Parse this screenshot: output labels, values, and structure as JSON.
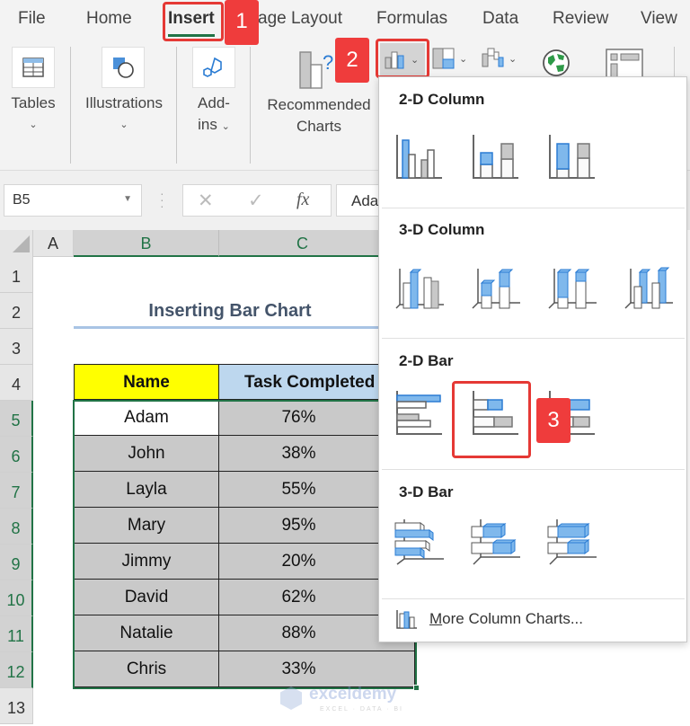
{
  "tabs": [
    {
      "label": "File"
    },
    {
      "label": "Home"
    },
    {
      "label": "Insert",
      "active": true
    },
    {
      "label": "age Layout"
    },
    {
      "label": "Formulas"
    },
    {
      "label": "Data"
    },
    {
      "label": "Review"
    },
    {
      "label": "View"
    }
  ],
  "callouts": {
    "step1": "1",
    "step2": "2",
    "step3": "3"
  },
  "ribbon": {
    "tables": "Tables",
    "illustrations": "Illustrations",
    "addins_line1": "Add-",
    "addins_line2": "ins",
    "recommended_line1": "Recommended",
    "recommended_line2": "Charts",
    "caret": "⌄"
  },
  "formula_bar": {
    "name_box": "B5",
    "cancel": "✕",
    "enter": "✓",
    "fx": "fx",
    "content": "Adam"
  },
  "grid": {
    "columns": [
      "A",
      "B",
      "C"
    ],
    "rows": [
      "1",
      "2",
      "3",
      "4",
      "5",
      "6",
      "7",
      "8",
      "9",
      "10",
      "11",
      "12",
      "13"
    ]
  },
  "sheet": {
    "title": "Inserting Bar Chart",
    "headers": {
      "name": "Name",
      "task": "Task Completed"
    },
    "rows": [
      {
        "name": "Adam",
        "pct": "76%"
      },
      {
        "name": "John",
        "pct": "38%"
      },
      {
        "name": "Layla",
        "pct": "55%"
      },
      {
        "name": "Mary",
        "pct": "95%"
      },
      {
        "name": "Jimmy",
        "pct": "20%"
      },
      {
        "name": "David",
        "pct": "62%"
      },
      {
        "name": "Natalie",
        "pct": "88%"
      },
      {
        "name": "Chris",
        "pct": "33%"
      }
    ]
  },
  "dropdown": {
    "sections": [
      {
        "title": "2-D Column",
        "items": [
          "Clustered Column",
          "Stacked Column",
          "100% Stacked Column"
        ]
      },
      {
        "title": "3-D Column",
        "items": [
          "3-D Clustered Column",
          "3-D Stacked Column",
          "3-D 100% Stacked Column",
          "3-D Column"
        ]
      },
      {
        "title": "2-D Bar",
        "items": [
          "Clustered Bar",
          "Stacked Bar",
          "100% Stacked Bar"
        ]
      },
      {
        "title": "3-D Bar",
        "items": [
          "3-D Clustered Bar",
          "3-D Stacked Bar",
          "3-D 100% Stacked Bar"
        ]
      }
    ],
    "more_prefix": "M",
    "more_rest": "ore Column Charts..."
  },
  "watermark": {
    "brand": "exceldemy",
    "tagline": "EXCEL · DATA · BI"
  },
  "colors": {
    "accent_green": "#217346",
    "callout_red": "#ef3c3c",
    "chart_blue": "#7fb8ec",
    "header_yellow": "#ffff00",
    "header_blue": "#bdd7ee"
  }
}
